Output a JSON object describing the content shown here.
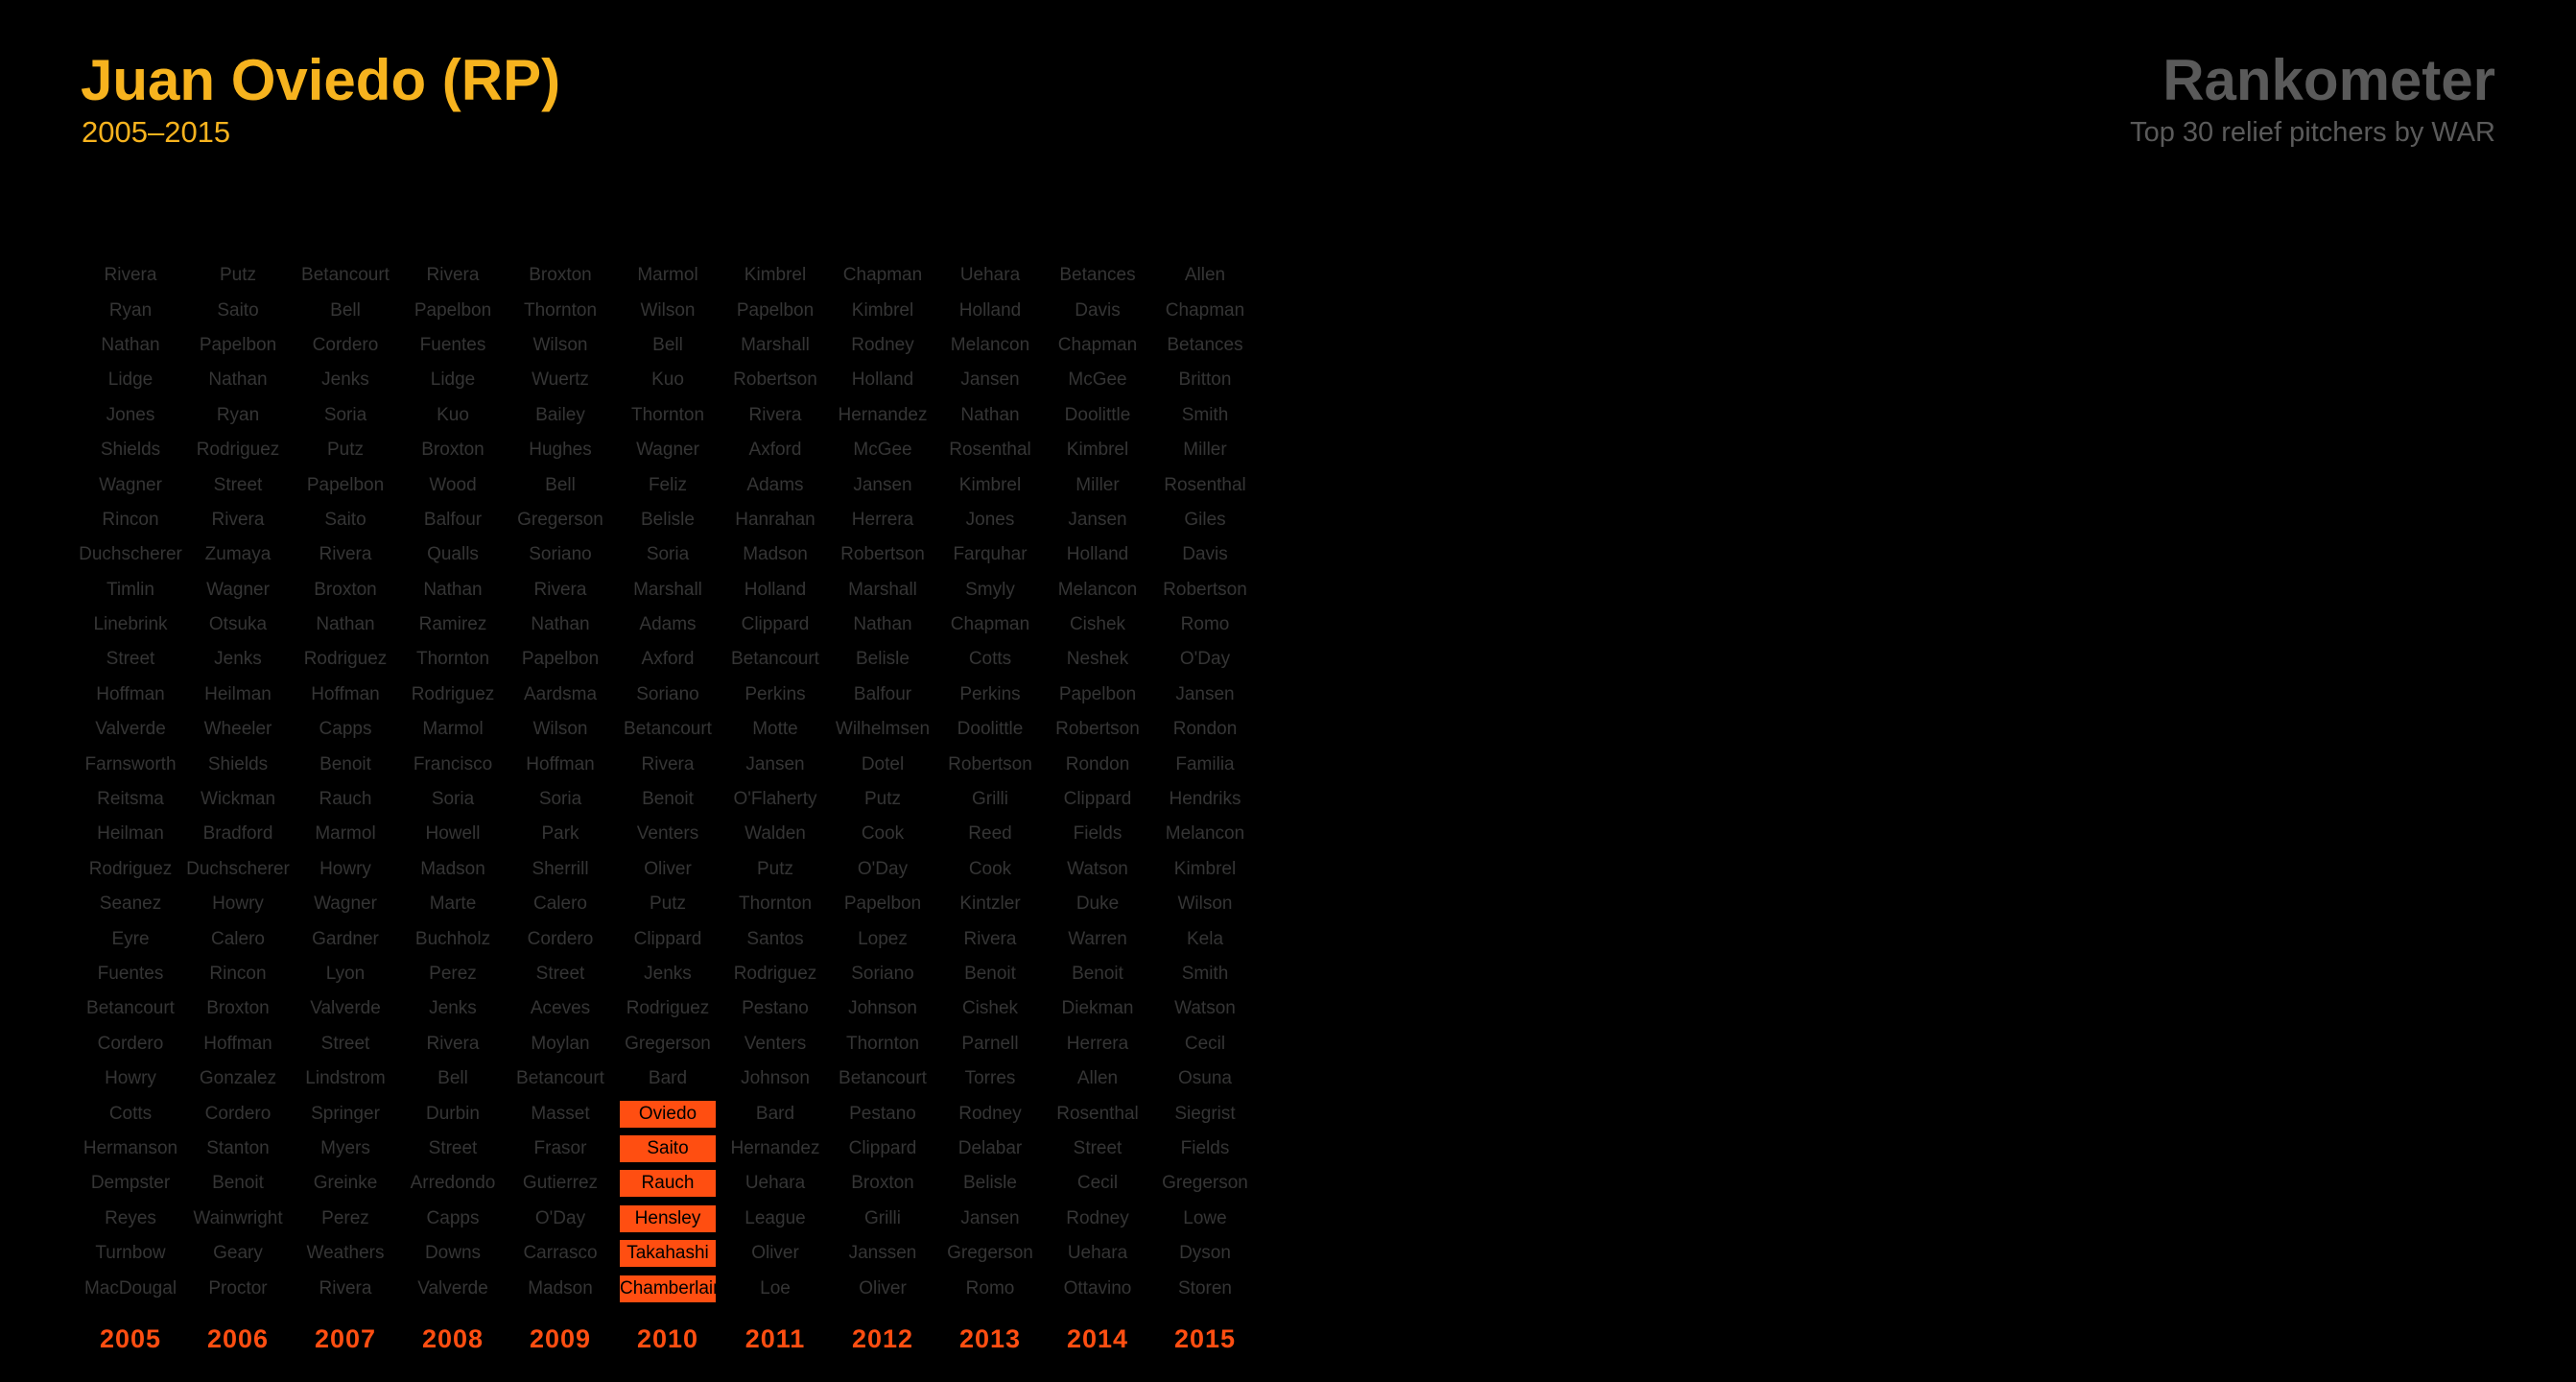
{
  "header": {
    "player_title": "Juan Oviedo (RP)",
    "player_years": "2005–2015",
    "brand_title": "Rankometer",
    "brand_subtitle": "Top 30 relief pitchers by WAR"
  },
  "colors": {
    "background": "#000000",
    "player_accent": "#f7b31e",
    "highlight": "#ff4e11",
    "muted_text": "#353535",
    "brand_text": "#5a5a5a"
  },
  "columns": [
    {
      "year": "2005",
      "names": [
        "Rivera",
        "Ryan",
        "Nathan",
        "Lidge",
        "Jones",
        "Shields",
        "Wagner",
        "Rincon",
        "Duchscherer",
        "Timlin",
        "Linebrink",
        "Street",
        "Hoffman",
        "Valverde",
        "Farnsworth",
        "Reitsma",
        "Heilman",
        "Rodriguez",
        "Seanez",
        "Eyre",
        "Fuentes",
        "Betancourt",
        "Cordero",
        "Howry",
        "Cotts",
        "Hermanson",
        "Dempster",
        "Reyes",
        "Turnbow",
        "MacDougal"
      ],
      "highlight": []
    },
    {
      "year": "2006",
      "names": [
        "Putz",
        "Saito",
        "Papelbon",
        "Nathan",
        "Ryan",
        "Rodriguez",
        "Street",
        "Rivera",
        "Zumaya",
        "Wagner",
        "Otsuka",
        "Jenks",
        "Heilman",
        "Wheeler",
        "Shields",
        "Wickman",
        "Bradford",
        "Duchscherer",
        "Howry",
        "Calero",
        "Rincon",
        "Broxton",
        "Hoffman",
        "Gonzalez",
        "Cordero",
        "Stanton",
        "Benoit",
        "Wainwright",
        "Geary",
        "Proctor"
      ],
      "highlight": []
    },
    {
      "year": "2007",
      "names": [
        "Betancourt",
        "Bell",
        "Cordero",
        "Jenks",
        "Soria",
        "Putz",
        "Papelbon",
        "Saito",
        "Rivera",
        "Broxton",
        "Nathan",
        "Rodriguez",
        "Hoffman",
        "Capps",
        "Benoit",
        "Rauch",
        "Marmol",
        "Howry",
        "Wagner",
        "Gardner",
        "Lyon",
        "Valverde",
        "Street",
        "Lindstrom",
        "Springer",
        "Myers",
        "Greinke",
        "Perez",
        "Weathers",
        "Rivera"
      ],
      "highlight": []
    },
    {
      "year": "2008",
      "names": [
        "Rivera",
        "Papelbon",
        "Fuentes",
        "Lidge",
        "Kuo",
        "Broxton",
        "Wood",
        "Balfour",
        "Qualls",
        "Nathan",
        "Ramirez",
        "Thornton",
        "Rodriguez",
        "Marmol",
        "Francisco",
        "Soria",
        "Howell",
        "Madson",
        "Marte",
        "Buchholz",
        "Perez",
        "Jenks",
        "Rivera",
        "Bell",
        "Durbin",
        "Street",
        "Arredondo",
        "Capps",
        "Downs",
        "Valverde"
      ],
      "highlight": []
    },
    {
      "year": "2009",
      "names": [
        "Broxton",
        "Thornton",
        "Wilson",
        "Wuertz",
        "Bailey",
        "Hughes",
        "Bell",
        "Gregerson",
        "Soriano",
        "Rivera",
        "Nathan",
        "Papelbon",
        "Aardsma",
        "Wilson",
        "Hoffman",
        "Soria",
        "Park",
        "Sherrill",
        "Calero",
        "Cordero",
        "Street",
        "Aceves",
        "Moylan",
        "Betancourt",
        "Masset",
        "Frasor",
        "Gutierrez",
        "O'Day",
        "Carrasco",
        "Madson"
      ],
      "highlight": []
    },
    {
      "year": "2010",
      "names": [
        "Marmol",
        "Wilson",
        "Bell",
        "Kuo",
        "Thornton",
        "Wagner",
        "Feliz",
        "Belisle",
        "Soria",
        "Marshall",
        "Adams",
        "Axford",
        "Soriano",
        "Betancourt",
        "Rivera",
        "Benoit",
        "Venters",
        "Oliver",
        "Putz",
        "Clippard",
        "Jenks",
        "Rodriguez",
        "Gregerson",
        "Bard",
        "Oviedo",
        "Saito",
        "Rauch",
        "Hensley",
        "Takahashi",
        "Chamberlain"
      ],
      "highlight": [
        24,
        25,
        26,
        27,
        28,
        29
      ]
    },
    {
      "year": "2011",
      "names": [
        "Kimbrel",
        "Papelbon",
        "Marshall",
        "Robertson",
        "Rivera",
        "Axford",
        "Adams",
        "Hanrahan",
        "Madson",
        "Holland",
        "Clippard",
        "Betancourt",
        "Perkins",
        "Motte",
        "Jansen",
        "O'Flaherty",
        "Walden",
        "Putz",
        "Thornton",
        "Santos",
        "Rodriguez",
        "Pestano",
        "Venters",
        "Johnson",
        "Bard",
        "Hernandez",
        "Uehara",
        "League",
        "Oliver",
        "Loe"
      ],
      "highlight": []
    },
    {
      "year": "2012",
      "names": [
        "Chapman",
        "Kimbrel",
        "Rodney",
        "Holland",
        "Hernandez",
        "McGee",
        "Jansen",
        "Herrera",
        "Robertson",
        "Marshall",
        "Nathan",
        "Belisle",
        "Balfour",
        "Wilhelmsen",
        "Dotel",
        "Putz",
        "Cook",
        "O'Day",
        "Papelbon",
        "Lopez",
        "Soriano",
        "Johnson",
        "Thornton",
        "Betancourt",
        "Pestano",
        "Clippard",
        "Broxton",
        "Grilli",
        "Janssen",
        "Oliver"
      ],
      "highlight": []
    },
    {
      "year": "2013",
      "names": [
        "Uehara",
        "Holland",
        "Melancon",
        "Jansen",
        "Nathan",
        "Rosenthal",
        "Kimbrel",
        "Jones",
        "Farquhar",
        "Smyly",
        "Chapman",
        "Cotts",
        "Perkins",
        "Doolittle",
        "Robertson",
        "Grilli",
        "Reed",
        "Cook",
        "Kintzler",
        "Rivera",
        "Benoit",
        "Cishek",
        "Parnell",
        "Torres",
        "Rodney",
        "Delabar",
        "Belisle",
        "Jansen",
        "Gregerson",
        "Romo"
      ],
      "highlight": []
    },
    {
      "year": "2014",
      "names": [
        "Betances",
        "Davis",
        "Chapman",
        "McGee",
        "Doolittle",
        "Kimbrel",
        "Miller",
        "Jansen",
        "Holland",
        "Melancon",
        "Cishek",
        "Neshek",
        "Papelbon",
        "Robertson",
        "Rondon",
        "Clippard",
        "Fields",
        "Watson",
        "Duke",
        "Warren",
        "Benoit",
        "Diekman",
        "Herrera",
        "Allen",
        "Rosenthal",
        "Street",
        "Cecil",
        "Rodney",
        "Uehara",
        "Ottavino"
      ],
      "highlight": []
    },
    {
      "year": "2015",
      "names": [
        "Allen",
        "Chapman",
        "Betances",
        "Britton",
        "Smith",
        "Miller",
        "Rosenthal",
        "Giles",
        "Davis",
        "Robertson",
        "Romo",
        "O'Day",
        "Jansen",
        "Rondon",
        "Familia",
        "Hendriks",
        "Melancon",
        "Kimbrel",
        "Wilson",
        "Kela",
        "Smith",
        "Watson",
        "Cecil",
        "Osuna",
        "Siegrist",
        "Fields",
        "Gregerson",
        "Lowe",
        "Dyson",
        "Storen"
      ],
      "highlight": []
    }
  ]
}
